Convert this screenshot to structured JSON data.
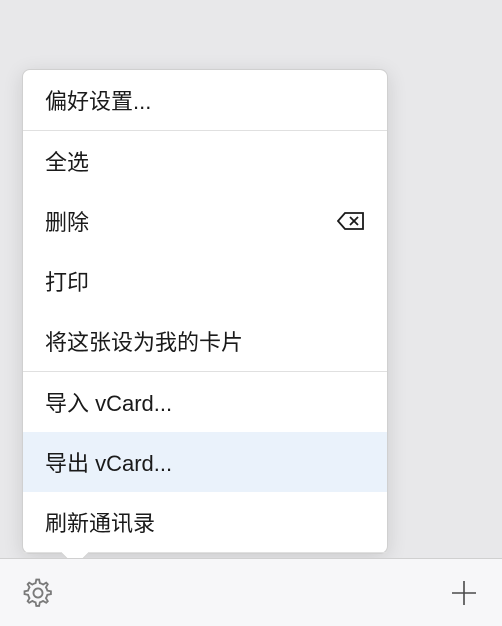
{
  "menu": {
    "preferences": "偏好设置...",
    "selectAll": "全选",
    "delete": "删除",
    "print": "打印",
    "setAsMyCard": "将这张设为我的卡片",
    "importVCard": "导入 vCard...",
    "exportVCard": "导出 vCard...",
    "refreshContacts": "刷新通讯录"
  },
  "icons": {
    "deleteKey": "delete-key-icon",
    "gear": "gear-icon",
    "plus": "plus-icon"
  }
}
